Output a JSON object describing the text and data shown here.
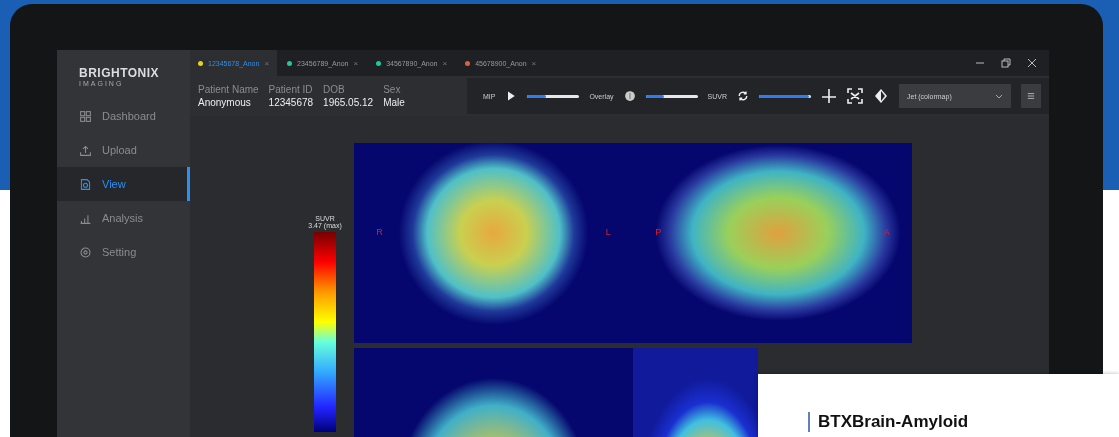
{
  "sidebar": {
    "logo": "BRIGHTONIX",
    "logo_sub": "IMAGING",
    "items": [
      {
        "label": "Dashboard",
        "selected": false
      },
      {
        "label": "Upload",
        "selected": false
      },
      {
        "label": "View",
        "selected": true
      },
      {
        "label": "Analysis",
        "selected": false
      },
      {
        "label": "Setting",
        "selected": false
      }
    ]
  },
  "tabs": [
    {
      "label": "12345678_Anon",
      "close": "×",
      "color": "#e8d21e",
      "selected": true
    },
    {
      "label": "23456789_Anon",
      "close": "×",
      "color": "#1ec8a0",
      "selected": false
    },
    {
      "label": "34567890_Anon",
      "close": "×",
      "color": "#1ec8a0",
      "selected": false
    },
    {
      "label": "45678900_Anon",
      "close": "×",
      "color": "#e0603a",
      "selected": false
    }
  ],
  "patient": [
    {
      "label": "Patient Name",
      "value": "Anonymous"
    },
    {
      "label": "Patient ID",
      "value": "12345678"
    },
    {
      "label": "DOB",
      "value": "1965.05.12"
    },
    {
      "label": "Sex",
      "value": "Male"
    }
  ],
  "toolbar": {
    "sliders": [
      {
        "label": "MIP",
        "level": 0.35
      },
      {
        "label": "Overlay",
        "level": 0.35
      },
      {
        "label": "SUVR",
        "level": 0.96
      }
    ],
    "colormap": "Jet (colormap)"
  },
  "colorbar": {
    "title": "SUVR",
    "max": "3.47 (max)"
  },
  "views": [
    {
      "kind": "coronal",
      "left": "R",
      "right": "L"
    },
    {
      "kind": "sagittal",
      "left": "P",
      "right": "A"
    },
    {
      "kind": "axial"
    },
    {
      "kind": "surface"
    }
  ],
  "card": {
    "title": "BTXBrain-Amyloid"
  }
}
